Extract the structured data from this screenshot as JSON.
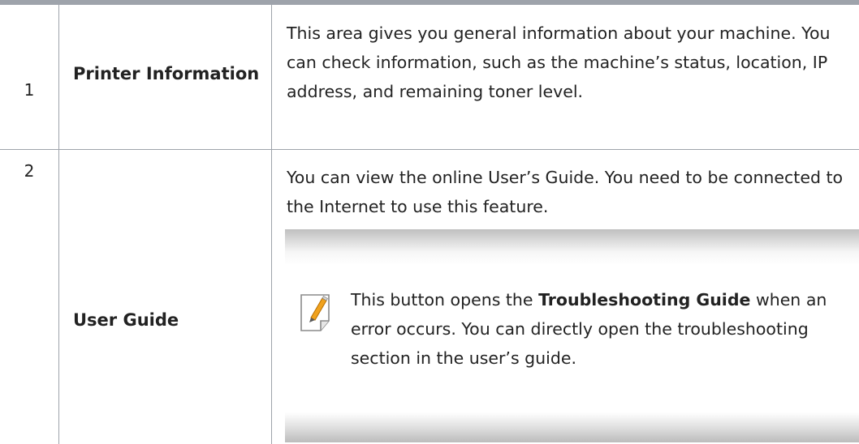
{
  "rows": [
    {
      "number": "1",
      "feature": "Printer Information",
      "description": "This area gives you general information about your machine. You can check information, such as the machine’s status, location, IP address, and remaining toner level."
    },
    {
      "number": "2",
      "feature": "User Guide",
      "description": "You can view the online User’s Guide. You need to be connected to the Internet to use this feature.",
      "note": {
        "icon": "note-pencil-icon",
        "text_before": "This button opens the ",
        "text_bold": "Troubleshooting Guide",
        "text_after": " when an error occurs. You can directly open the troubleshooting section in the user’s guide."
      }
    }
  ],
  "colors": {
    "rule": "#9ea3ab",
    "text": "#222222",
    "icon_accent": "#f0a21e"
  }
}
